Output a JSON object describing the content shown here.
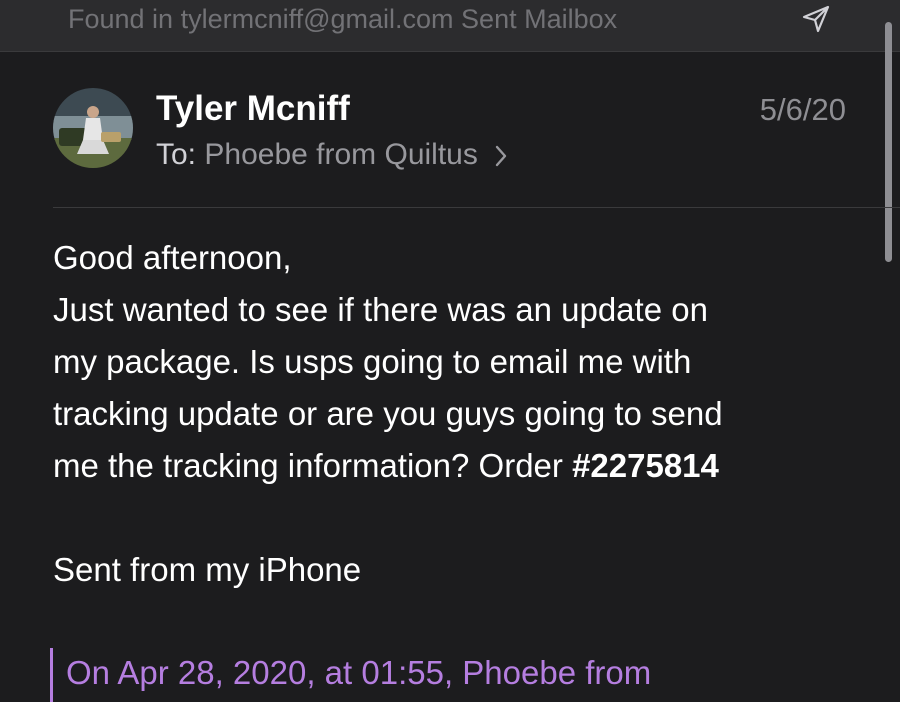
{
  "banner": {
    "text": "Found in tylermcniff@gmail.com Sent Mailbox",
    "icon": "send-icon"
  },
  "message": {
    "sender": "Tyler Mcniff",
    "date": "5/6/20",
    "to_label": "To:",
    "to_name": "Phoebe from Quiltus",
    "body": {
      "greeting": "Good afternoon,",
      "line1": "Just wanted to see if there was an update on",
      "line2": "my package. Is usps going to email me with",
      "line3": "tracking update or are you guys going to send",
      "line4_prefix": "me the tracking information? Order ",
      "order_number": "#2275814",
      "signature": "Sent from my iPhone"
    },
    "quote_header": "On Apr 28, 2020, at 01:55, Phoebe from"
  },
  "colors": {
    "background": "#1c1c1e",
    "banner": "#2c2c2e",
    "quote_accent": "#b57ee0"
  }
}
